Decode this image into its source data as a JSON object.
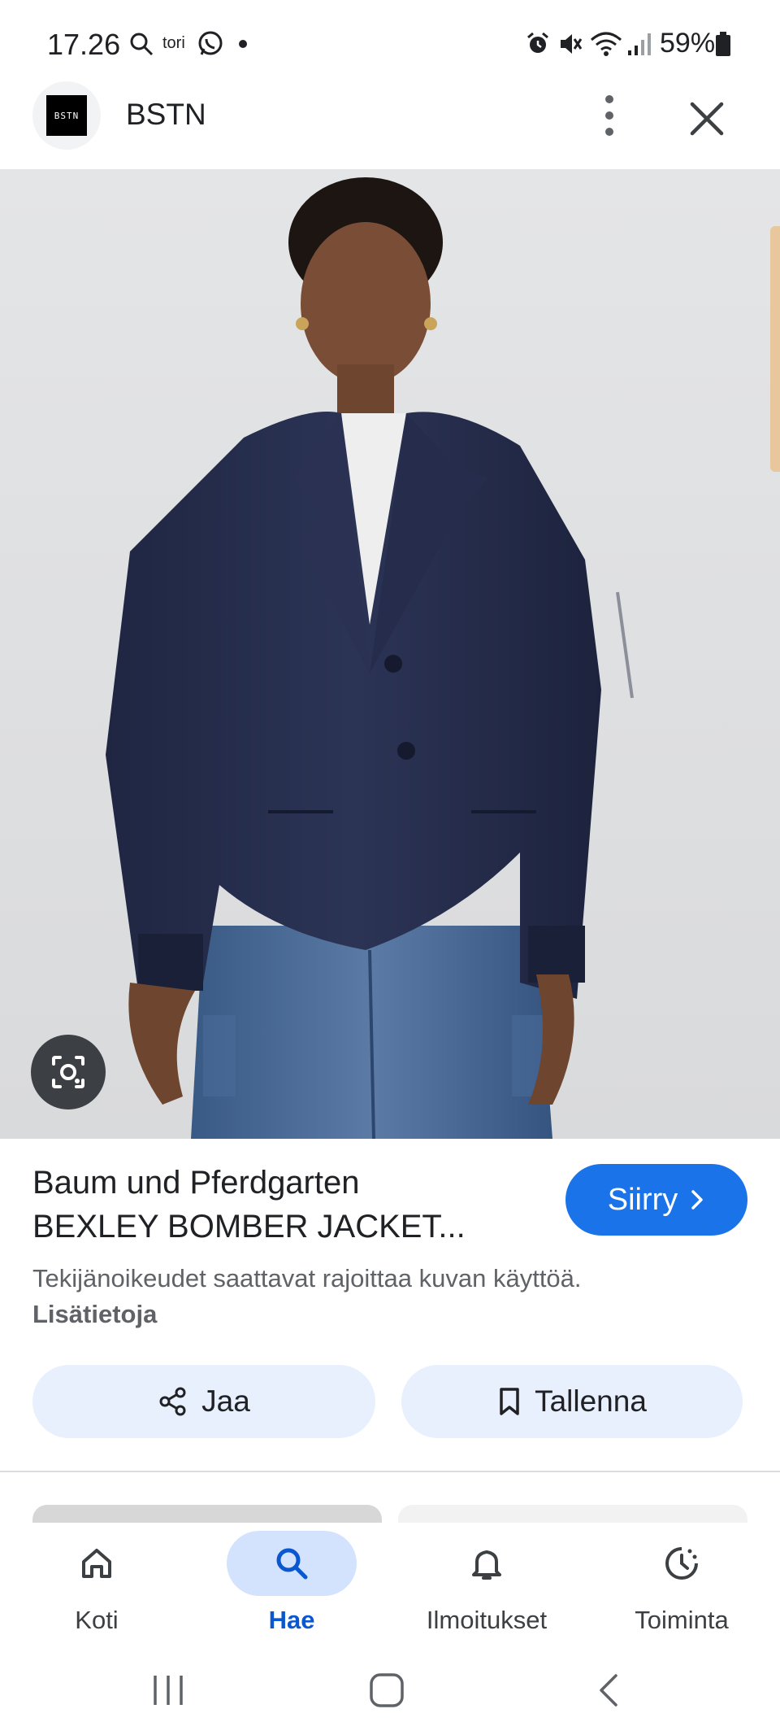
{
  "status_bar": {
    "time": "17.26",
    "carrier_icon_text": "tori",
    "battery": "59%"
  },
  "header": {
    "logo_text": "BSTN",
    "site_name": "BSTN"
  },
  "result": {
    "title_line1": "Baum und Pferdgarten",
    "title_line2": "BEXLEY BOMBER JACKET...",
    "visit_label": "Siirry",
    "copyright_text": "Tekijänoikeudet saattavat rajoittaa kuvan käyttöä.",
    "more_info_link": "Lisätietoja",
    "share_label": "Jaa",
    "save_label": "Tallenna"
  },
  "bottom_nav": [
    {
      "label": "Koti",
      "icon": "home-icon",
      "active": false
    },
    {
      "label": "Hae",
      "icon": "search-icon",
      "active": true
    },
    {
      "label": "Ilmoitukset",
      "icon": "bell-icon",
      "active": false
    },
    {
      "label": "Toiminta",
      "icon": "activity-icon",
      "active": false
    }
  ],
  "colors": {
    "accent": "#1a73e8",
    "active_nav": "#0b57d0",
    "button_bg": "#e8f0fe",
    "jacket": "#252c4b"
  }
}
